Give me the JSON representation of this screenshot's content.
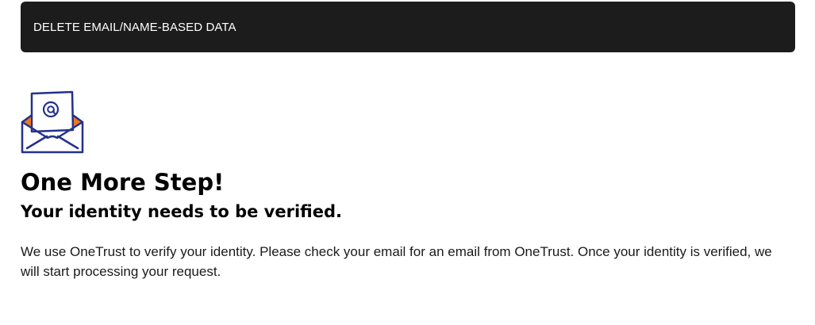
{
  "header": {
    "title": "DELETE EMAIL/NAME-BASED DATA"
  },
  "icon": {
    "name": "envelope-at-icon",
    "colors": {
      "outline": "#23318c",
      "accent": "#e9791e"
    }
  },
  "main": {
    "heading": "One More Step!",
    "subheading": "Your identity needs to be verified.",
    "body": "We use OneTrust to verify your identity. Please check your email for an email from OneTrust. Once your identity is verified, we will start processing your request."
  }
}
